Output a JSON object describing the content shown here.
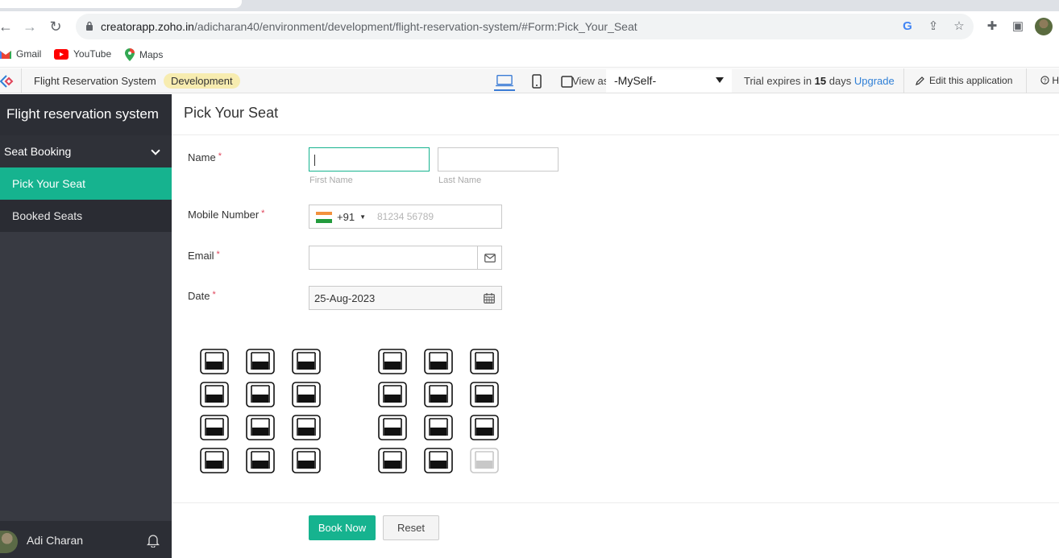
{
  "browser": {
    "url_host": "creatorapp.zoho.in",
    "url_path": "/adicharan40/environment/development/flight-reservation-system/#Form:Pick_Your_Seat",
    "bookmarks": [
      {
        "label": "Gmail",
        "icon": "gmail-icon"
      },
      {
        "label": "YouTube",
        "icon": "youtube-icon"
      },
      {
        "label": "Maps",
        "icon": "maps-icon"
      }
    ]
  },
  "creator_bar": {
    "app_name": "Flight Reservation System",
    "env_badge": "Development",
    "view_as_label": "View as",
    "view_as_value": "-MySelf-",
    "trial_prefix": "Trial expires in",
    "trial_days": "15",
    "trial_suffix": "days",
    "upgrade_label": "Upgrade",
    "edit_label": "Edit this application",
    "help_label": "H"
  },
  "sidebar": {
    "app_title": "Flight reservation system",
    "section_label": "Seat Booking",
    "items": [
      {
        "label": "Pick Your Seat",
        "active": true
      },
      {
        "label": "Booked Seats",
        "active": false
      }
    ],
    "user_name": "Adi Charan"
  },
  "form": {
    "title": "Pick Your Seat",
    "name_label": "Name",
    "first_name_sublabel": "First Name",
    "last_name_sublabel": "Last Name",
    "mobile_label": "Mobile Number",
    "country_code": "+91",
    "mobile_placeholder": "81234 56789",
    "email_label": "Email",
    "date_label": "Date",
    "date_value": "25-Aug-2023",
    "required_mark": "*",
    "submit_label": "Book Now",
    "reset_label": "Reset"
  },
  "seats": {
    "rows": 4,
    "seats_per_side": 3,
    "unavailable": [
      "row4-right-seat3"
    ]
  },
  "colors": {
    "accent": "#16b38f",
    "sidebar_bg": "#383a42",
    "badge_bg": "#f7ecb0",
    "link": "#2f7fd6"
  }
}
